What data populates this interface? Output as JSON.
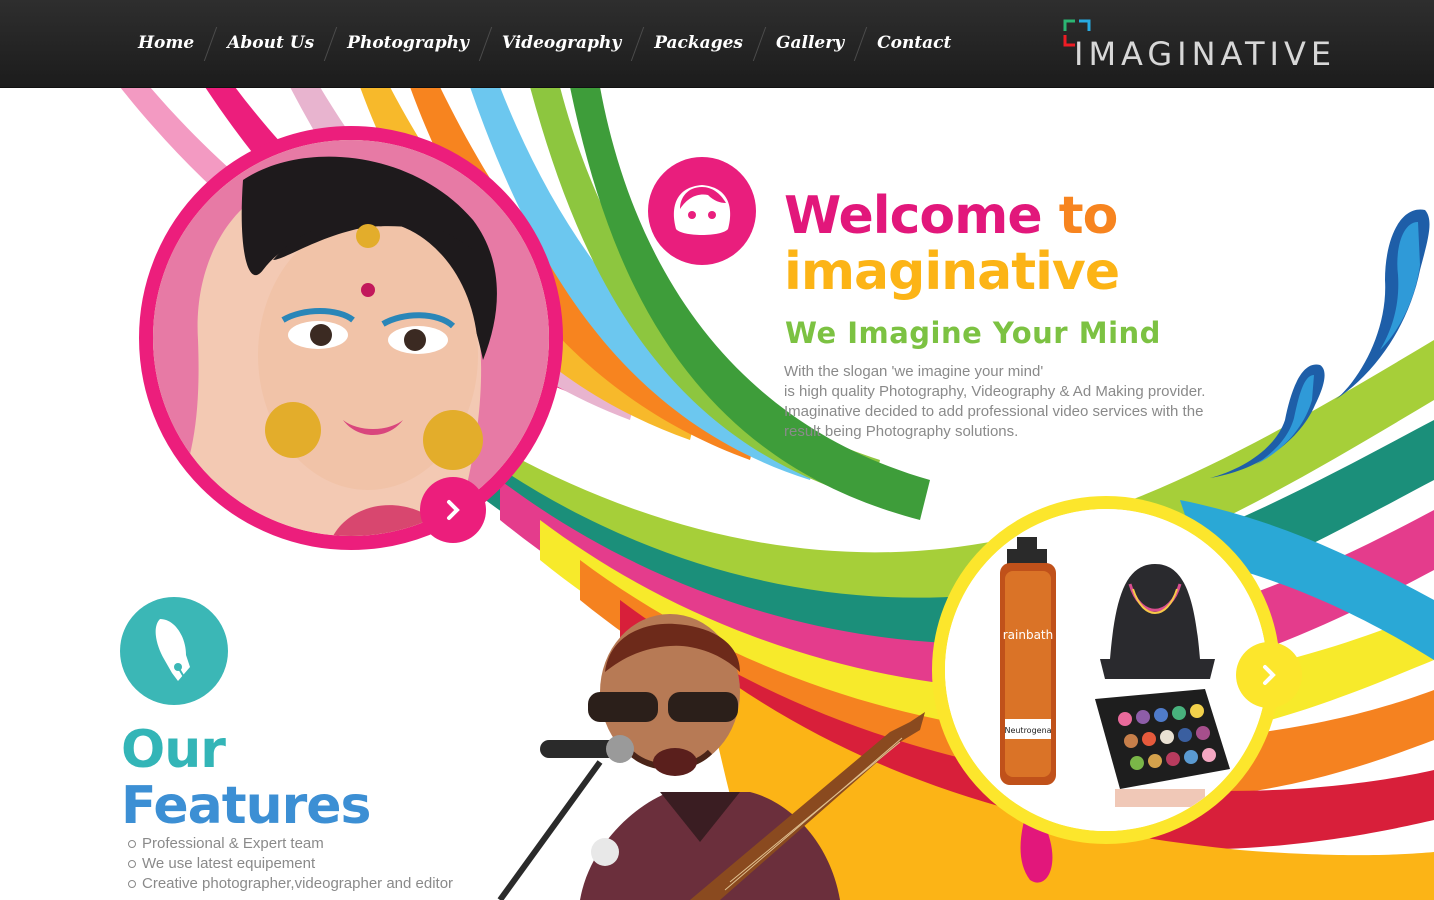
{
  "nav": {
    "items": [
      "Home",
      "About Us",
      "Photography",
      "Videography",
      "Packages",
      "Gallery",
      "Contact"
    ]
  },
  "logo": {
    "text": "IMAGINATIVE"
  },
  "welcome": {
    "title_part1": "Welcome",
    "title_part2": "to",
    "title_part3": "imaginative",
    "tagline": "We Imagine Your Mind",
    "description_lines": [
      "With the slogan 'we imagine your mind'",
      "is high quality Photography, Videography & Ad Making provider.",
      "Imaginative decided to add professional video services with the",
      "result being Photography solutions."
    ]
  },
  "features": {
    "title_line1": "Our",
    "title_line2": "Features",
    "items": [
      "Professional & Expert team",
      "We use latest equipement",
      "Creative photographer,videographer and editor"
    ]
  },
  "products": {
    "bottle_label": "rainbath",
    "bottle_brand": "Neutrogena"
  },
  "colors": {
    "pink": "#ec1e7c",
    "orange": "#f7841f",
    "yellow": "#fcb416",
    "green": "#7cc242",
    "teal": "#33b5b7",
    "blue": "#3c8fd4",
    "nav_bg": "#232323"
  },
  "icons": [
    "face-icon",
    "pen-nib-icon",
    "chevron-right-icon"
  ]
}
